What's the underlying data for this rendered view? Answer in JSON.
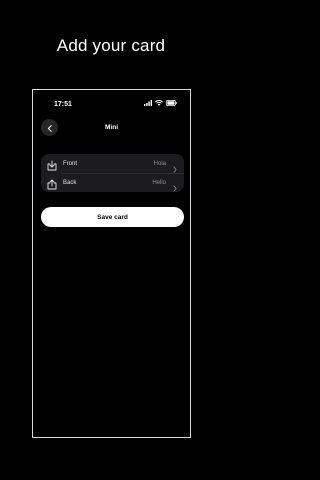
{
  "headline": "Add your card",
  "status_bar": {
    "time": "17:51"
  },
  "nav": {
    "title": "Mini",
    "back_icon": "chevron-left-icon"
  },
  "card_sides": [
    {
      "label": "Front",
      "value": "Hola",
      "icon": "download-tray-icon"
    },
    {
      "label": "Back",
      "value": "Hello",
      "icon": "upload-tray-icon"
    }
  ],
  "save_label": "Save card",
  "colors": {
    "background": "#000000",
    "group_background": "#1c1c1e",
    "secondary_text": "#8e8e93",
    "button_background": "#ffffff"
  }
}
